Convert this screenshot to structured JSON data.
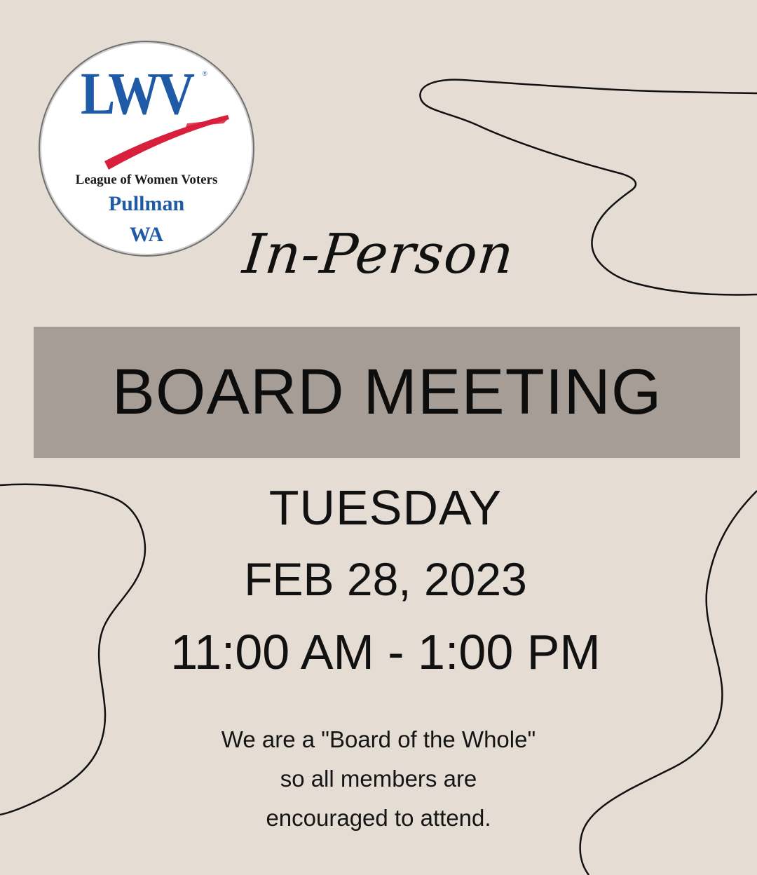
{
  "logo": {
    "abbreviation": "LWV",
    "registered_mark": "®",
    "organization": "League of Women Voters",
    "city": "Pullman",
    "state": "WA"
  },
  "heading": {
    "script_title": "In-Person",
    "banner_title": "BOARD MEETING"
  },
  "event": {
    "day": "TUESDAY",
    "date": "FEB 28, 2023",
    "time": "11:00 AM - 1:00 PM"
  },
  "note": {
    "line1": "We are a \"Board of the Whole\"",
    "line2": "so all members are",
    "line3": "encouraged to attend."
  },
  "colors": {
    "background": "#e5dcd4",
    "banner": "#a69d96",
    "logo_blue": "#1f5aa6",
    "logo_red": "#d81f3b",
    "text": "#111111"
  }
}
